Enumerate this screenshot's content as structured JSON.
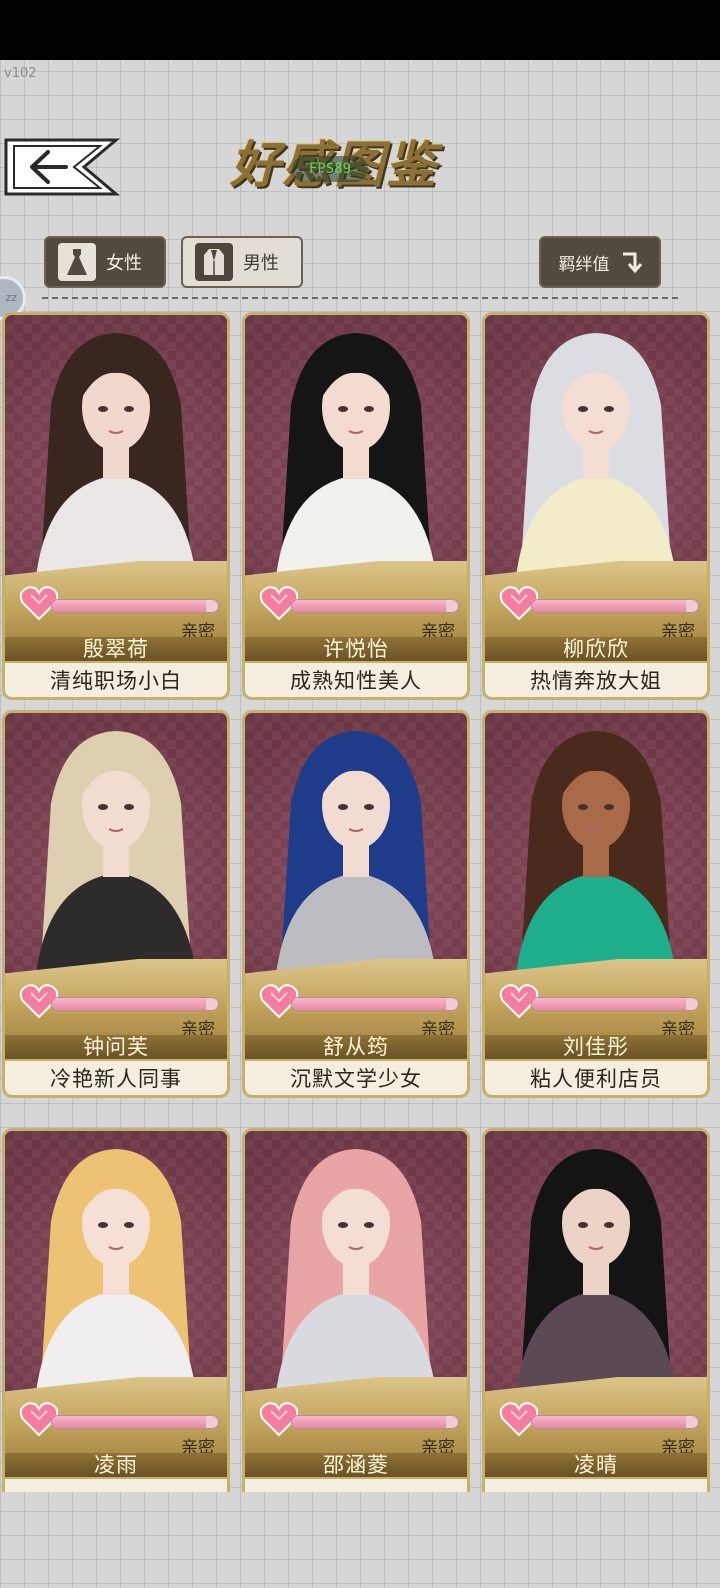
{
  "header": {
    "version": "v102",
    "title": "好感图鉴",
    "fps": "FPS89"
  },
  "tabs": [
    {
      "label": "女性",
      "icon": "dress-icon",
      "active": true
    },
    {
      "label": "男性",
      "icon": "suit-icon",
      "active": false
    }
  ],
  "bond_button": {
    "label": "羁绊值",
    "icon": "sort-arrow-icon"
  },
  "side_handle": "zz",
  "colors": {
    "card_bg": "#7e3f51",
    "gold": "#c9b06a",
    "tab_dark": "#524a3e",
    "affection": "#e48aa5"
  },
  "cards": [
    {
      "name": "殷翠荷",
      "title": "清纯职场小白",
      "affection_label": "亲密",
      "affection": 0.93,
      "hair": "#3a2620",
      "skin": "#f0d8cc",
      "outfit": "#ebe7e6"
    },
    {
      "name": "许悦怡",
      "title": "成熟知性美人",
      "affection_label": "亲密",
      "affection": 0.93,
      "hair": "#151515",
      "skin": "#f3dccf",
      "outfit": "#f1f1ee"
    },
    {
      "name": "柳欣欣",
      "title": "热情奔放大姐",
      "affection_label": "亲密",
      "affection": 0.93,
      "hair": "#dcdde3",
      "skin": "#f4ddd2",
      "outfit": "#f2ecc8"
    },
    {
      "name": "钟问芙",
      "title": "冷艳新人同事",
      "affection_label": "亲密",
      "affection": 0.93,
      "hair": "#ddcfb0",
      "skin": "#f2dccf",
      "outfit": "#2d2b2c"
    },
    {
      "name": "舒从筠",
      "title": "沉默文学少女",
      "affection_label": "亲密",
      "affection": 0.93,
      "hair": "#1f3c8a",
      "skin": "#f2dcd2",
      "outfit": "#bdbdc1"
    },
    {
      "name": "刘佳彤",
      "title": "粘人便利店员",
      "affection_label": "亲密",
      "affection": 0.93,
      "hair": "#4a2a1c",
      "skin": "#a86a48",
      "outfit": "#1fae8c"
    },
    {
      "name": "凌雨",
      "title": "",
      "affection_label": "亲密",
      "affection": 0.93,
      "hair": "#eec275",
      "skin": "#f6e0d5",
      "outfit": "#f0eeee"
    },
    {
      "name": "邵涵菱",
      "title": "",
      "affection_label": "亲密",
      "affection": 0.93,
      "hair": "#e9a4a6",
      "skin": "#f4ddd3",
      "outfit": "#d9dadf"
    },
    {
      "name": "凌晴",
      "title": "",
      "affection_label": "亲密",
      "affection": 0.93,
      "hair": "#141414",
      "skin": "#ecd3c6",
      "outfit": "#5b4a55"
    }
  ]
}
